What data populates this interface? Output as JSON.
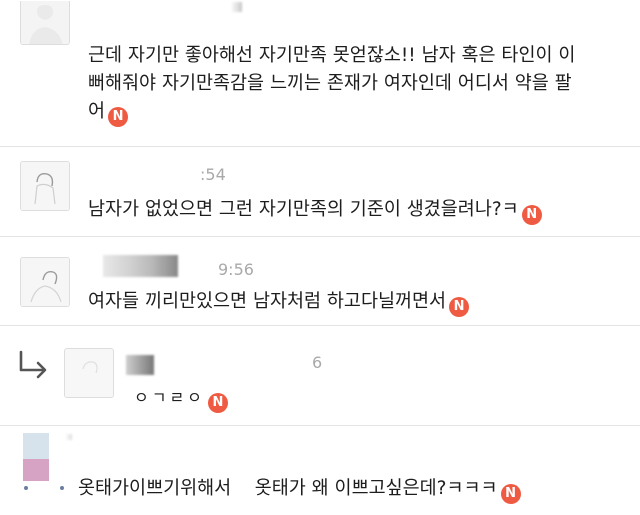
{
  "badge_label": "N",
  "comments": [
    {
      "lines": [
        "근데 자기만 좋아해선 자기만족 못얻잖소!! 남자 혹은 타인이 이",
        "뻐해줘야 자기만족감을 느끼는 존재가 여자인데 어디서 약을 팔",
        "어"
      ]
    },
    {
      "time": ":54",
      "text": "남자가 없었으면 그런 자기만족의 기준이 생겼을려나?ㅋ"
    },
    {
      "time": "9:56",
      "text": "여자들 끼리만있으면 남자처럼 하고다닐꺼면서"
    },
    {
      "time": "6",
      "text": "ㅇㄱㄹㅇ"
    },
    {
      "text": "옷태가이쁘기위해서    옷태가 왜 이쁘고싶은데?ㅋㅋㅋ"
    }
  ],
  "colors": {
    "badge": "#ef5b42",
    "divider": "#e4e4e4",
    "text": "#1d1d1d",
    "meta": "#a9a9a9"
  }
}
